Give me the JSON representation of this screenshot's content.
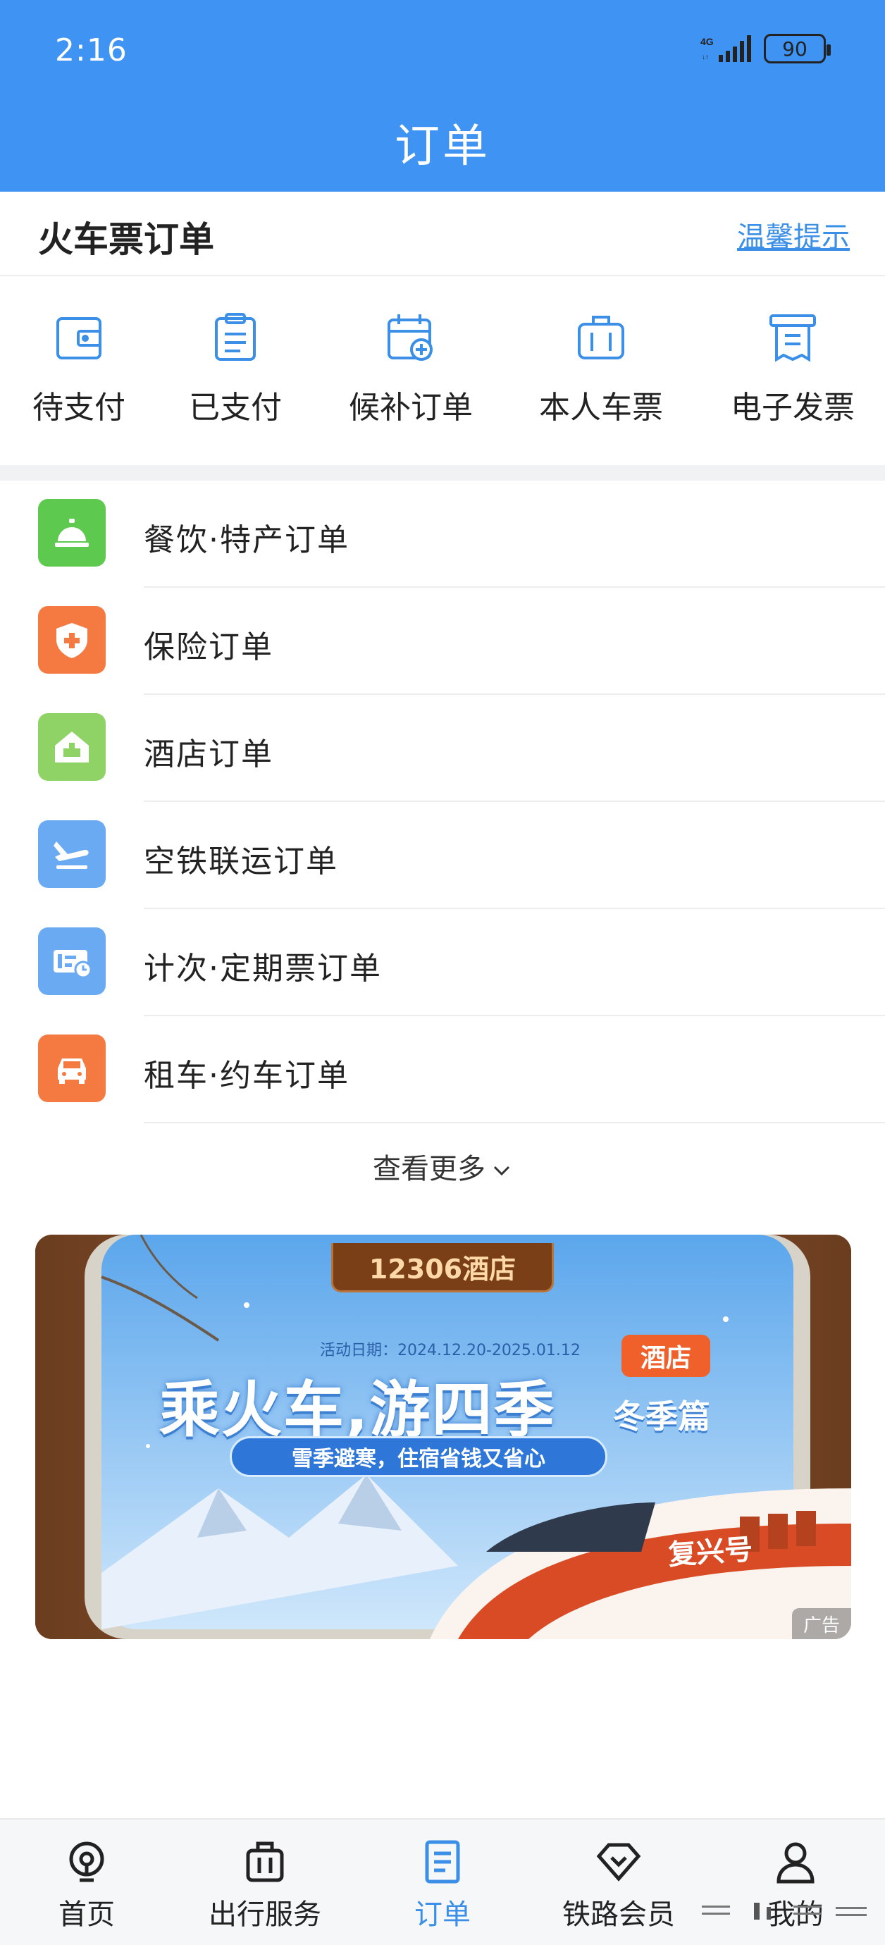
{
  "status_bar": {
    "time": "2:16",
    "network": "4G",
    "battery": "90"
  },
  "header": {
    "title": "订单"
  },
  "ticket_section": {
    "title": "火车票订单",
    "tips_link": "温馨提示",
    "quick_actions": [
      {
        "label": "待支付",
        "icon": "wallet-icon"
      },
      {
        "label": "已支付",
        "icon": "clipboard-icon"
      },
      {
        "label": "候补订单",
        "icon": "calendar-plus-icon"
      },
      {
        "label": "本人车票",
        "icon": "luggage-icon"
      },
      {
        "label": "电子发票",
        "icon": "invoice-icon"
      }
    ]
  },
  "orders": [
    {
      "label": "餐饮·特产订单",
      "icon": "service-bell-icon",
      "color": "#5ec94f"
    },
    {
      "label": "保险订单",
      "icon": "shield-plus-icon",
      "color": "#f47a42"
    },
    {
      "label": "酒店订单",
      "icon": "hotel-icon",
      "color": "#8fd367"
    },
    {
      "label": "空铁联运订单",
      "icon": "plane-icon",
      "color": "#6aaaf2"
    },
    {
      "label": "计次·定期票订单",
      "icon": "ticket-clock-icon",
      "color": "#6aaaf2"
    },
    {
      "label": "租车·约车订单",
      "icon": "car-icon",
      "color": "#f47a42"
    }
  ],
  "see_more": "查看更多",
  "banner": {
    "tag": "12306酒店",
    "date": "活动日期：2024.12.20-2025.01.12",
    "headline": "乘火车,游四季",
    "season": "冬季篇",
    "hotel_badge": "酒店",
    "subline": "雪季避寒，住宿省钱又省心",
    "train_name": "复兴号",
    "ad_label": "广告"
  },
  "tabbar": [
    {
      "label": "首页",
      "icon": "train-front-icon",
      "active": false
    },
    {
      "label": "出行服务",
      "icon": "suitcase-icon",
      "active": false
    },
    {
      "label": "订单",
      "icon": "order-doc-icon",
      "active": true
    },
    {
      "label": "铁路会员",
      "icon": "diamond-icon",
      "active": false
    },
    {
      "label": "我的",
      "icon": "person-icon",
      "active": false
    }
  ],
  "colors": {
    "primary": "#3f93f2",
    "link": "#3b8fe7"
  }
}
